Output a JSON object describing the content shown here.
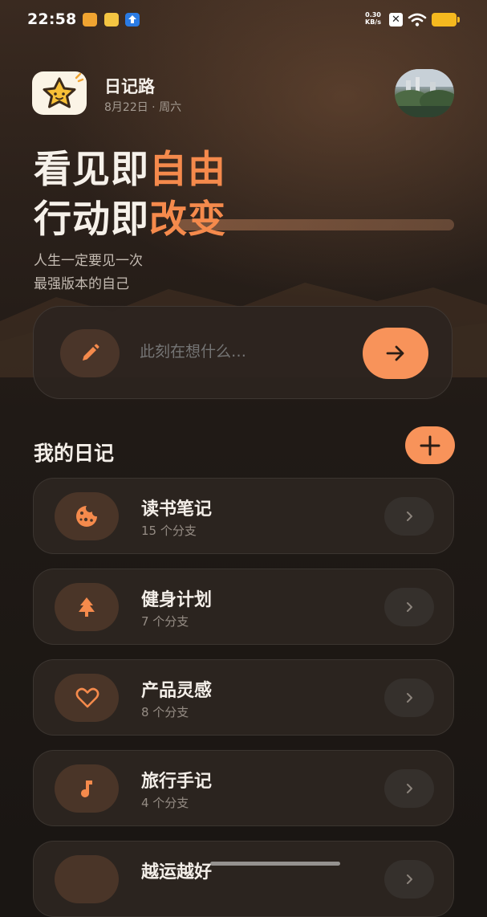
{
  "status_bar": {
    "time": "22:58",
    "net_speed_value": "0.30",
    "net_speed_unit": "KB/s",
    "battery_color": "#f5b91f"
  },
  "header": {
    "app_name": "日记路",
    "date": "8月22日 · 周六"
  },
  "hero": {
    "line1_prefix": "看见即",
    "line1_accent": "自由",
    "line2_prefix": "行动即",
    "line2_accent": "改变",
    "subtitle1": "人生一定要见一次",
    "subtitle2": "最强版本的自己",
    "accent_color": "#f58a4c"
  },
  "composer": {
    "placeholder": "此刻在想什么…",
    "icon": "pencil-icon",
    "submit_icon": "arrow-right-icon"
  },
  "section": {
    "title": "我的日记",
    "add_icon": "plus-icon"
  },
  "diaries": [
    {
      "title": "读书笔记",
      "sub": "15 个分支",
      "icon": "cookie-icon"
    },
    {
      "title": "健身计划",
      "sub": "7 个分支",
      "icon": "tree-icon"
    },
    {
      "title": "产品灵感",
      "sub": "8 个分支",
      "icon": "heart-icon"
    },
    {
      "title": "旅行手记",
      "sub": "4 个分支",
      "icon": "music-note-icon"
    },
    {
      "title": "越运越好",
      "sub": "",
      "icon": "chevron-right-icon"
    }
  ]
}
